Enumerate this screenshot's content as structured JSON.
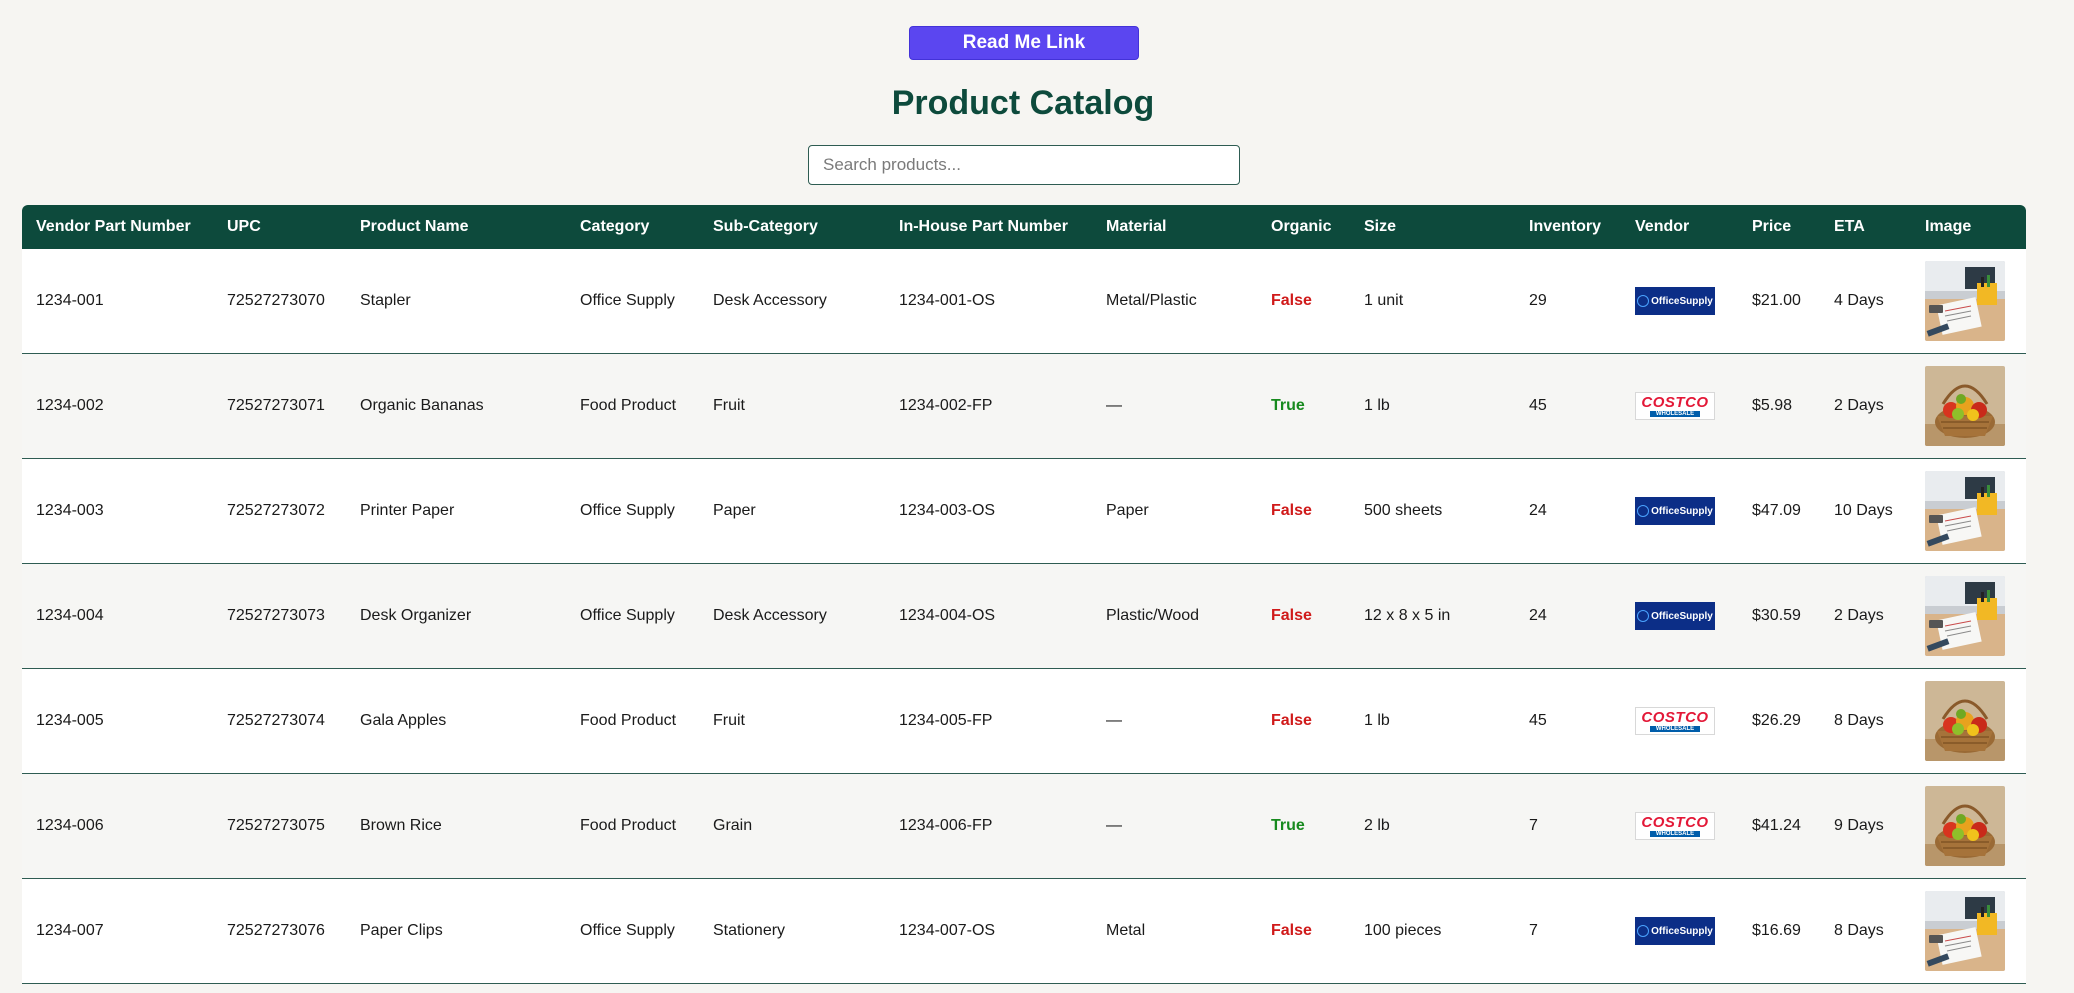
{
  "header": {
    "readme_label": "Read Me Link",
    "title": "Product Catalog",
    "search_placeholder": "Search products..."
  },
  "table": {
    "columns": [
      "Vendor Part Number",
      "UPC",
      "Product Name",
      "Category",
      "Sub-Category",
      "In-House Part Number",
      "Material",
      "Organic",
      "Size",
      "Inventory",
      "Vendor",
      "Price",
      "ETA",
      "Image"
    ],
    "rows": [
      {
        "vendor_part": "1234-001",
        "upc": "72527273070",
        "name": "Stapler",
        "category": "Office Supply",
        "subcategory": "Desk Accessory",
        "inhouse": "1234-001-OS",
        "material": "Metal/Plastic",
        "organic": "False",
        "size": "1 unit",
        "inventory": "29",
        "vendor": "officesupply-logo",
        "price": "$21.00",
        "eta": "4 Days",
        "image": "desk-photo"
      },
      {
        "vendor_part": "1234-002",
        "upc": "72527273071",
        "name": "Organic Bananas",
        "category": "Food Product",
        "subcategory": "Fruit",
        "inhouse": "1234-002-FP",
        "material": "—",
        "organic": "True",
        "size": "1 lb",
        "inventory": "45",
        "vendor": "costco-logo",
        "price": "$5.98",
        "eta": "2 Days",
        "image": "fruit-basket-photo"
      },
      {
        "vendor_part": "1234-003",
        "upc": "72527273072",
        "name": "Printer Paper",
        "category": "Office Supply",
        "subcategory": "Paper",
        "inhouse": "1234-003-OS",
        "material": "Paper",
        "organic": "False",
        "size": "500 sheets",
        "inventory": "24",
        "vendor": "officesupply-logo",
        "price": "$47.09",
        "eta": "10 Days",
        "image": "desk-photo"
      },
      {
        "vendor_part": "1234-004",
        "upc": "72527273073",
        "name": "Desk Organizer",
        "category": "Office Supply",
        "subcategory": "Desk Accessory",
        "inhouse": "1234-004-OS",
        "material": "Plastic/Wood",
        "organic": "False",
        "size": "12 x 8 x 5 in",
        "inventory": "24",
        "vendor": "officesupply-logo",
        "price": "$30.59",
        "eta": "2 Days",
        "image": "desk-photo"
      },
      {
        "vendor_part": "1234-005",
        "upc": "72527273074",
        "name": "Gala Apples",
        "category": "Food Product",
        "subcategory": "Fruit",
        "inhouse": "1234-005-FP",
        "material": "—",
        "organic": "False",
        "size": "1 lb",
        "inventory": "45",
        "vendor": "costco-logo",
        "price": "$26.29",
        "eta": "8 Days",
        "image": "fruit-basket-photo"
      },
      {
        "vendor_part": "1234-006",
        "upc": "72527273075",
        "name": "Brown Rice",
        "category": "Food Product",
        "subcategory": "Grain",
        "inhouse": "1234-006-FP",
        "material": "—",
        "organic": "True",
        "size": "2 lb",
        "inventory": "7",
        "vendor": "costco-logo",
        "price": "$41.24",
        "eta": "9 Days",
        "image": "fruit-basket-photo"
      },
      {
        "vendor_part": "1234-007",
        "upc": "72527273076",
        "name": "Paper Clips",
        "category": "Office Supply",
        "subcategory": "Stationery",
        "inhouse": "1234-007-OS",
        "material": "Metal",
        "organic": "False",
        "size": "100 pieces",
        "inventory": "7",
        "vendor": "officesupply-logo",
        "price": "$16.69",
        "eta": "8 Days",
        "image": "desk-photo"
      }
    ]
  },
  "logos": {
    "officesupply_text": "OfficeSupply",
    "costco_text": "COSTCO",
    "costco_sub": "WHOLESALE"
  },
  "colors": {
    "accent_button": "#5b46f0",
    "header_green": "#0d4a3c",
    "organic_true": "#178a1e",
    "organic_false": "#d01a1a"
  }
}
